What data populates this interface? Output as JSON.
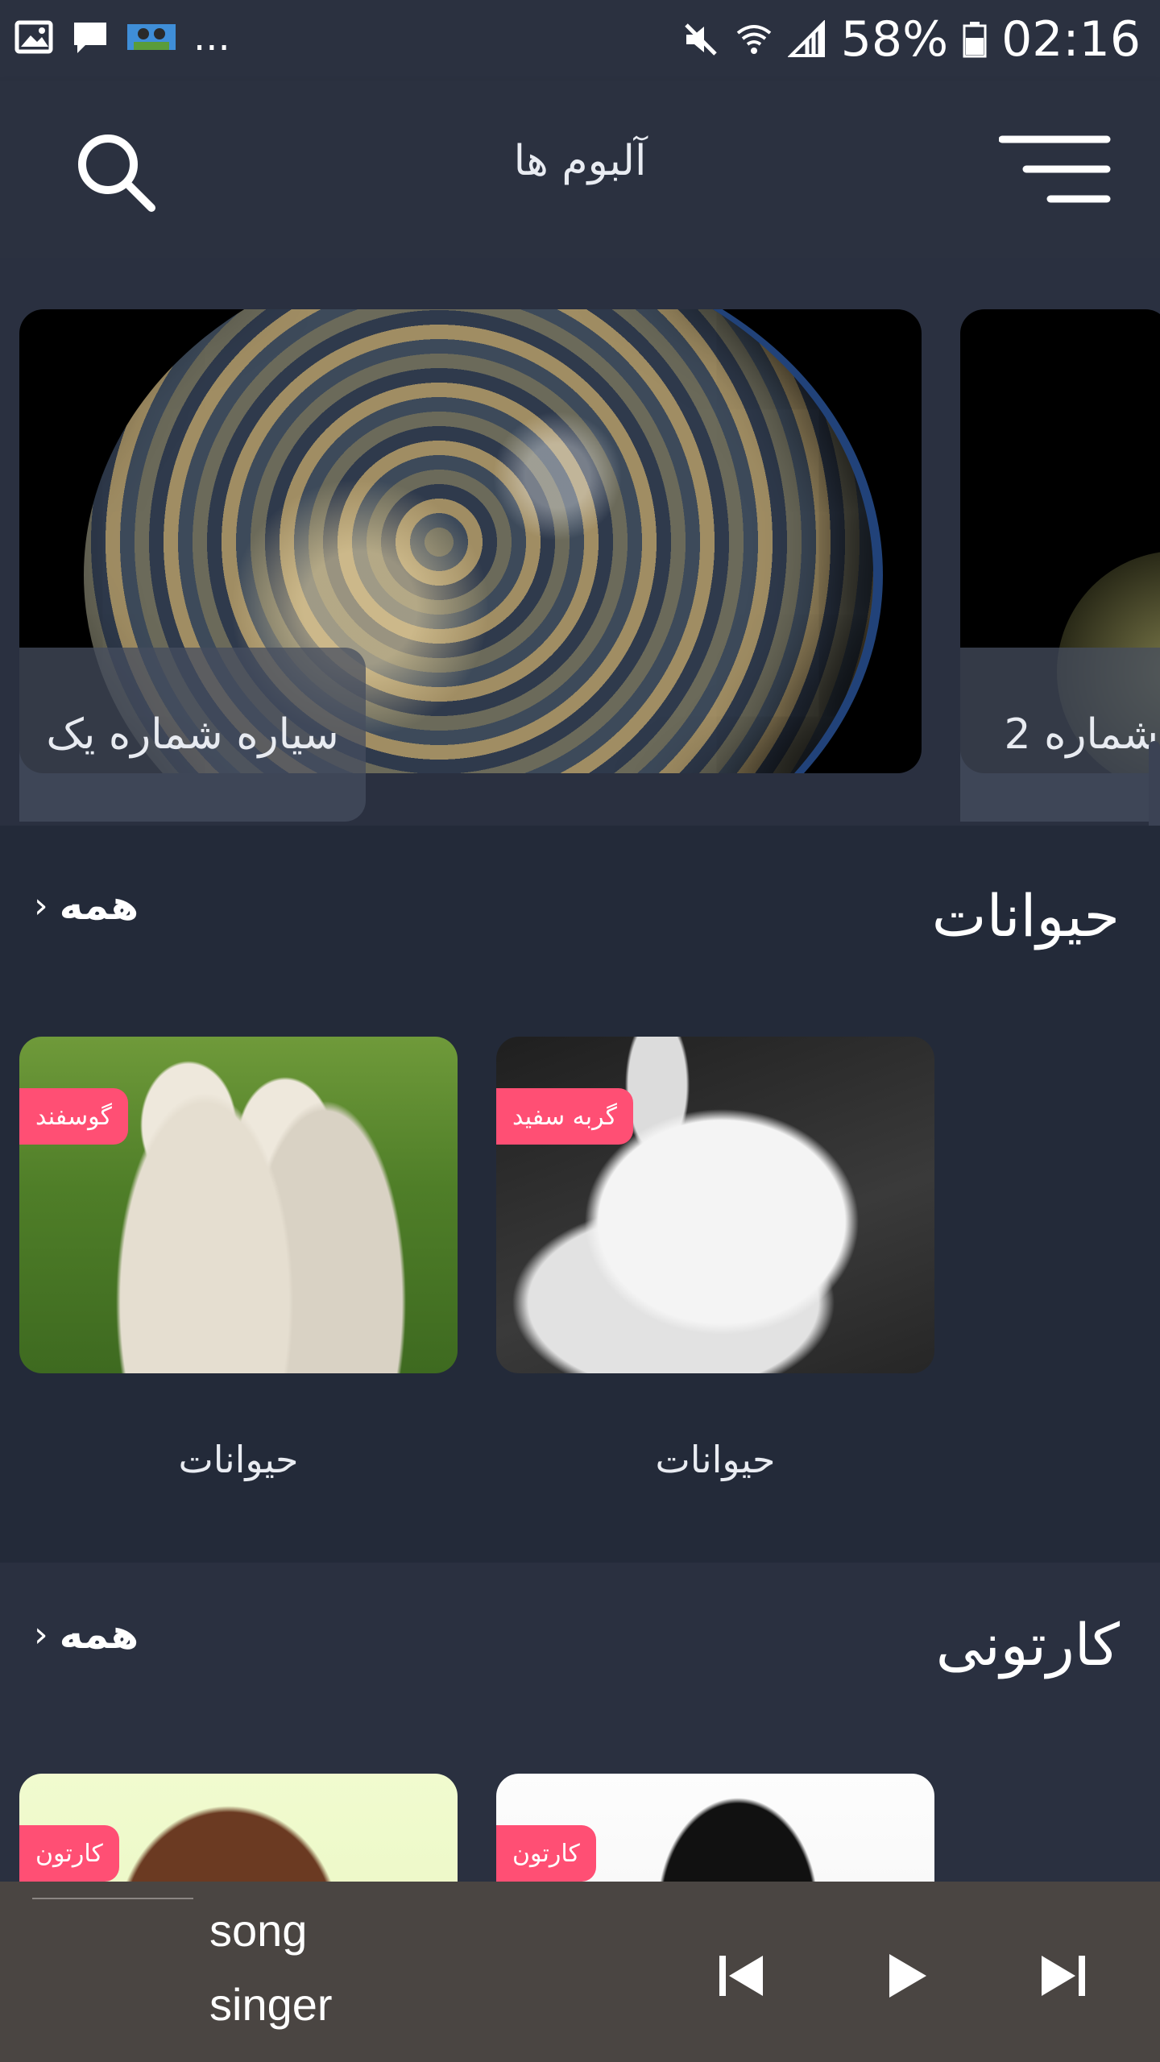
{
  "status_bar": {
    "time": "02:16",
    "battery": "58%",
    "more": "...",
    "icons": [
      "gallery-icon",
      "message-icon",
      "app-thumb-icon",
      "mute-icon",
      "wifi-icon",
      "signal-icon",
      "battery-icon"
    ]
  },
  "app_bar": {
    "title": "آلبوم ها",
    "search_icon": "search-icon",
    "menu_icon": "menu-icon"
  },
  "carousel": {
    "slides": [
      {
        "caption": "سیاره شماره یک"
      },
      {
        "caption": "شماره 2"
      }
    ]
  },
  "sections": [
    {
      "title": "حیوانات",
      "all_label": "همه",
      "chevron": "›",
      "cards": [
        {
          "badge": "گربه سفید",
          "label": "حیوانات",
          "image": "white-kitten"
        },
        {
          "badge": "گوسفند",
          "label": "حیوانات",
          "image": "two-lambs"
        }
      ]
    },
    {
      "title": "کارتونی",
      "all_label": "همه",
      "chevron": "›",
      "cards": [
        {
          "badge": "کارتون",
          "image": "penguin-cartoon"
        },
        {
          "badge": "کارتون",
          "image": "domo-cartoon"
        }
      ]
    }
  ],
  "player": {
    "song": "song",
    "singer": "singer",
    "controls": [
      "previous-icon",
      "play-icon",
      "next-icon"
    ]
  },
  "colors": {
    "background": "#2a3040",
    "section_alt": "#232a39",
    "badge": "#ff4f74",
    "player_bg": "#4a4542"
  }
}
